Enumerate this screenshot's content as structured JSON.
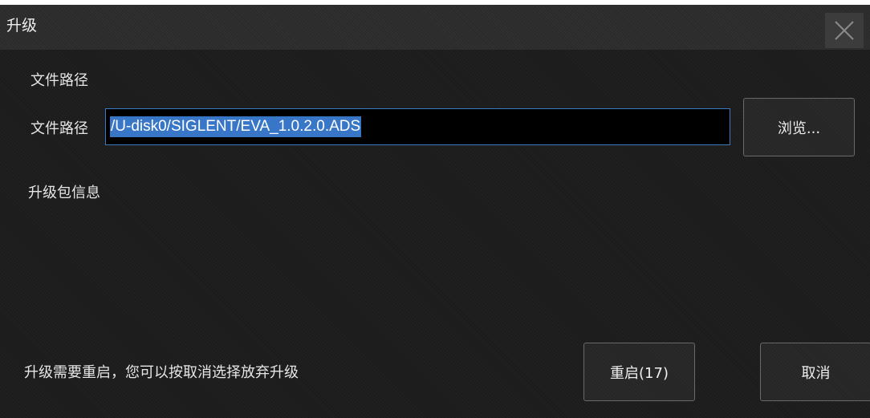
{
  "dialog": {
    "title": "升级",
    "close_icon": "close-icon"
  },
  "file_section": {
    "heading": "文件路径",
    "path_label": "文件路径",
    "path_value": "/U-disk0/SIGLENT/EVA_1.0.2.0.ADS",
    "browse_label": "浏览..."
  },
  "package_info": {
    "heading": "升级包信息"
  },
  "footer": {
    "message": "升级需要重启，您可以按取消选择放弃升级",
    "restart_label": "重启(17)",
    "cancel_label": "取消"
  },
  "colors": {
    "dialog_bg": "#1c1c1c",
    "titlebar_bg": "#2b2b2b",
    "input_border": "#3d7ac2",
    "selection": "#3876c8"
  }
}
